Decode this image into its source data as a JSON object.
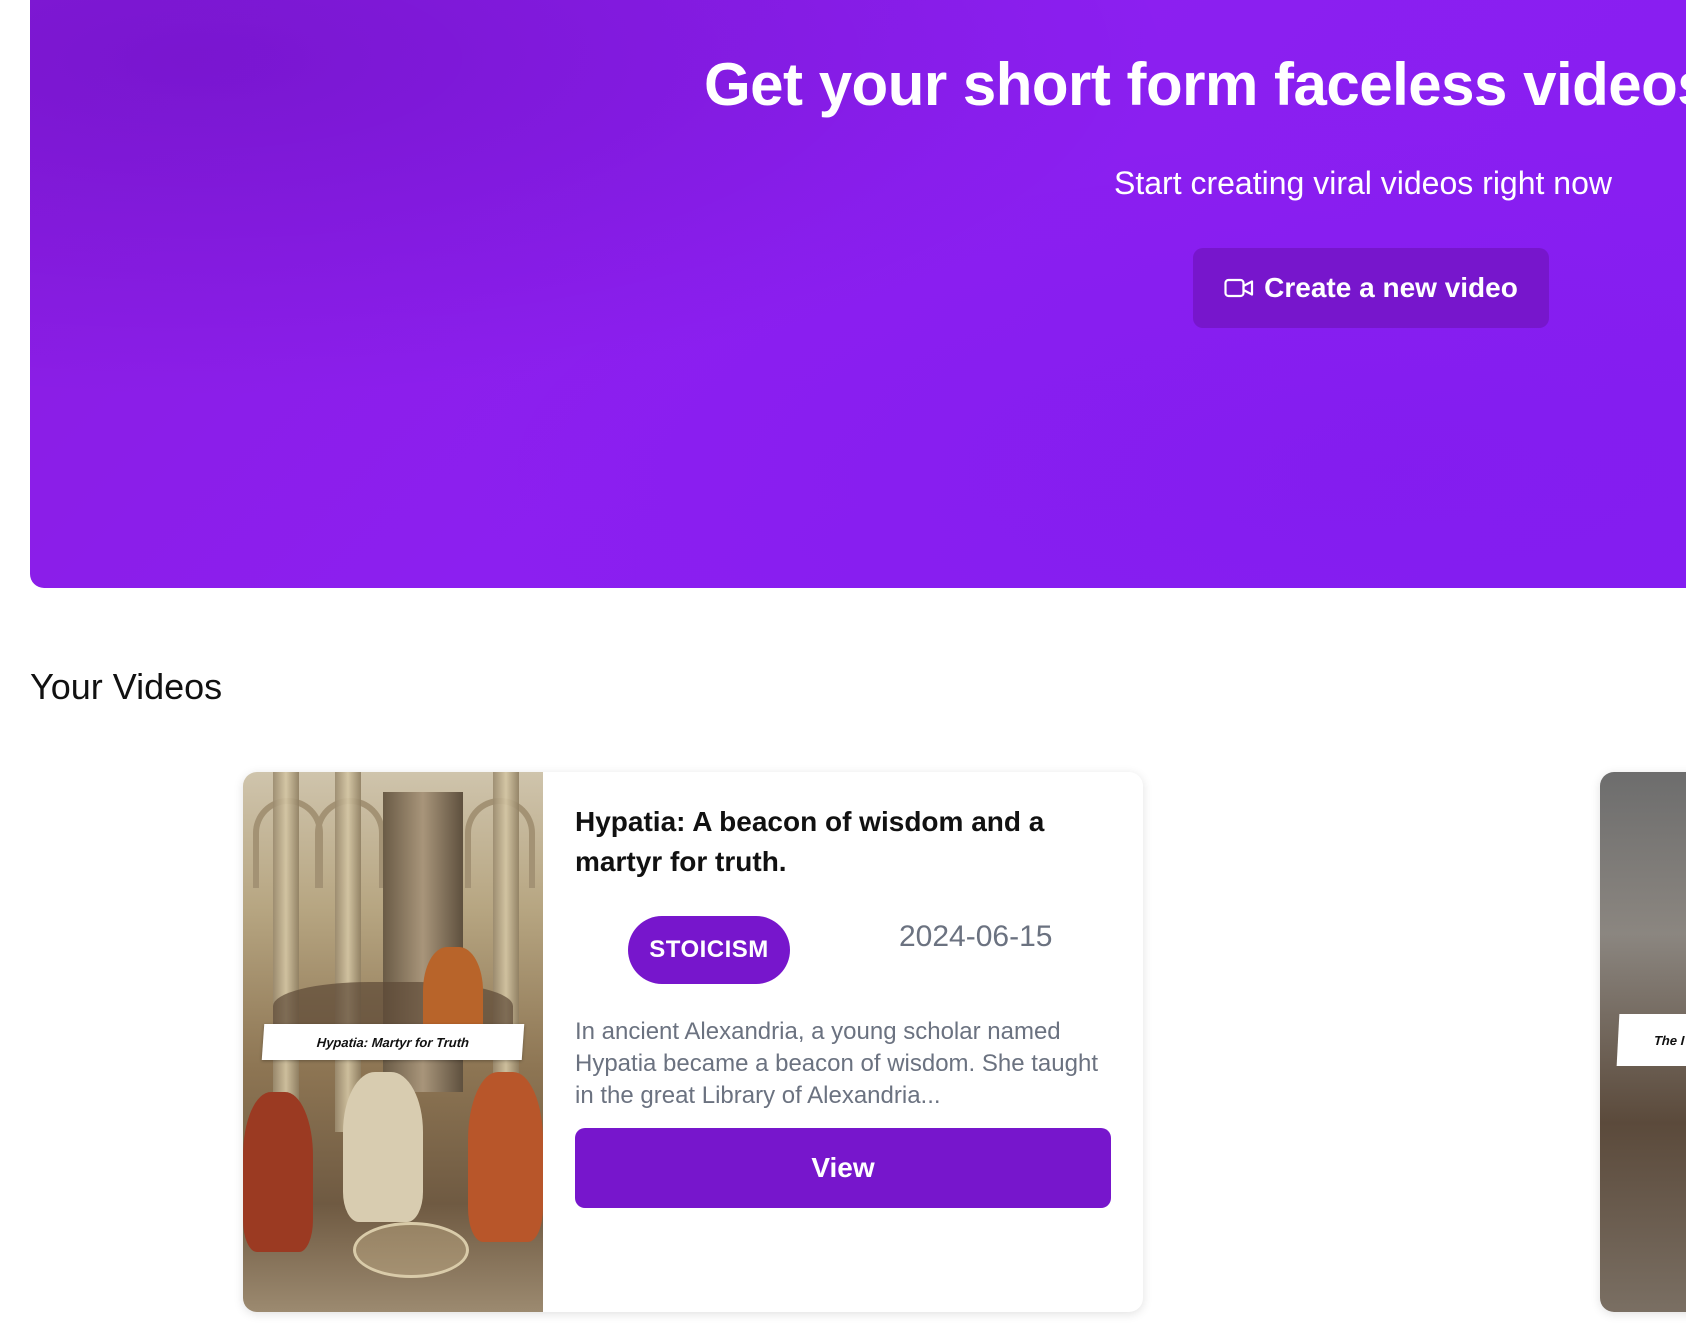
{
  "hero": {
    "title": "Get your short form faceless videos",
    "subtitle": "Start creating viral videos right now",
    "create_button_label": "Create a new video",
    "create_button_icon": "video-camera-icon",
    "background_color": "#8c1ff0"
  },
  "videos_section": {
    "title": "Your Videos",
    "cards": [
      {
        "title": "Hypatia: A beacon of wisdom and a martyr for truth.",
        "thumbnail_caption": "Hypatia: Martyr for Truth",
        "tag": "STOICISM",
        "date": "2024-06-15",
        "description": "In ancient Alexandria, a young scholar named Hypatia became a beacon of wisdom. She taught in the great Library of Alexandria...",
        "view_label": "View"
      },
      {
        "thumbnail_caption": "The I"
      }
    ]
  },
  "colors": {
    "accent": "#7716cc",
    "muted_text": "#6b7280"
  }
}
